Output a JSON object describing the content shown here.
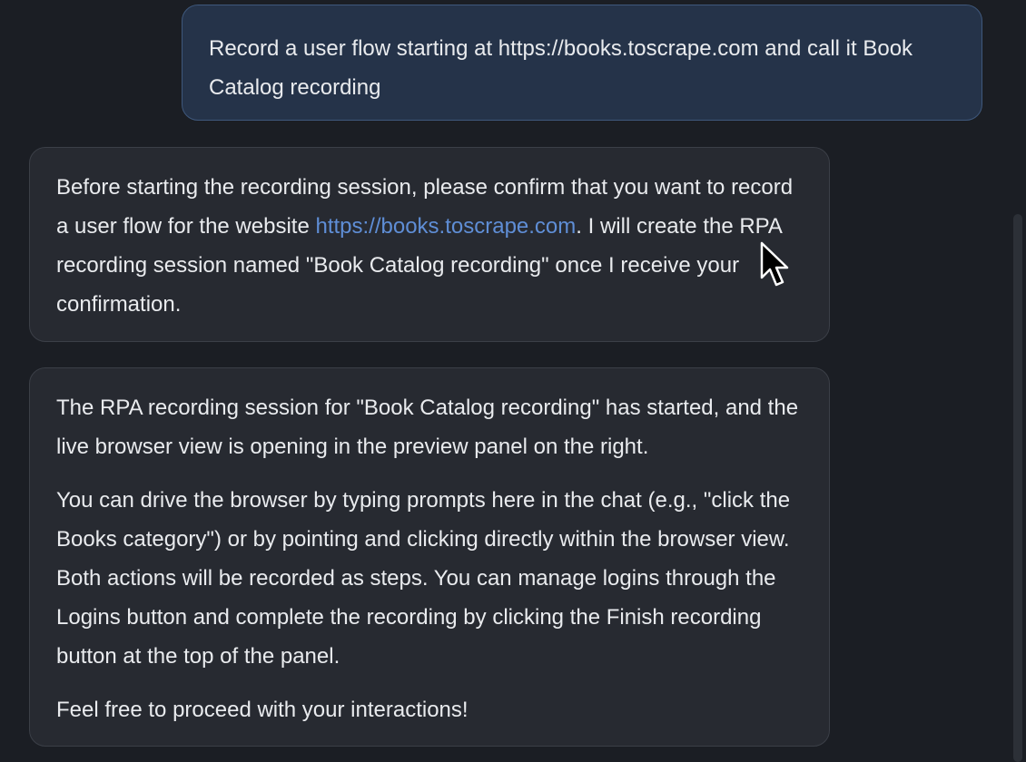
{
  "messages": {
    "user": {
      "text": "Record a user flow starting at https://books.toscrape.com and call it Book Catalog recording"
    },
    "assistant_1": {
      "text_before": "Before starting the recording session, please confirm that you want to record a user flow for the website ",
      "link": "https://books.toscrape.com",
      "text_after": ". I will create the RPA recording session named \"Book Catalog recording\" once I receive your confirmation."
    },
    "assistant_2": {
      "paragraphs": [
        "The RPA recording session for \"Book Catalog recording\" has started, and the live browser view is opening in the preview panel on the right.",
        "You can drive the browser by typing prompts here in the chat (e.g., \"click the Books category\") or by pointing and clicking directly within the browser view. Both actions will be recorded as steps. You can manage logins through the Logins button and complete the recording by clicking the Finish recording button at the top of the panel.",
        "Feel free to proceed with your interactions!"
      ]
    }
  },
  "icons": {
    "cursor": "mouse-pointer-icon"
  },
  "colors": {
    "background": "#1b1e24",
    "user_bubble": "#253349",
    "assistant_bubble": "#272a31",
    "link": "#5f8ed6"
  }
}
